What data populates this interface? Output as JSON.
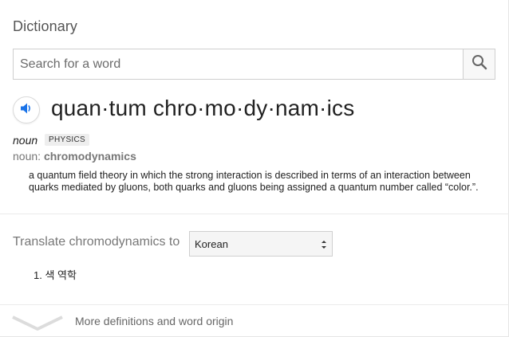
{
  "panel": {
    "title": "Dictionary"
  },
  "search": {
    "placeholder": "Search for a word",
    "value": "",
    "button_icon": "search-icon"
  },
  "entry": {
    "audio_icon": "speaker-icon",
    "headword": "quan·tum chro·mo·dy·nam·ics",
    "part_of_speech": "noun",
    "domain": "PHYSICS",
    "variant_prefix": "noun:",
    "variant_word": "chromodynamics",
    "definition": "a quantum field theory in which the strong interaction is described in terms of an interaction between quarks mediated by gluons, both quarks and gluons being assigned a quantum number called “color.”."
  },
  "translate": {
    "label": "Translate chromodynamics to",
    "selected_language": "Korean",
    "results": [
      "1. 색 역학"
    ]
  },
  "footer": {
    "more_label": "More definitions and word origin",
    "icon": "chevron-down-icon"
  },
  "colors": {
    "accent_blue": "#1a73e8",
    "muted_text": "#777777"
  }
}
